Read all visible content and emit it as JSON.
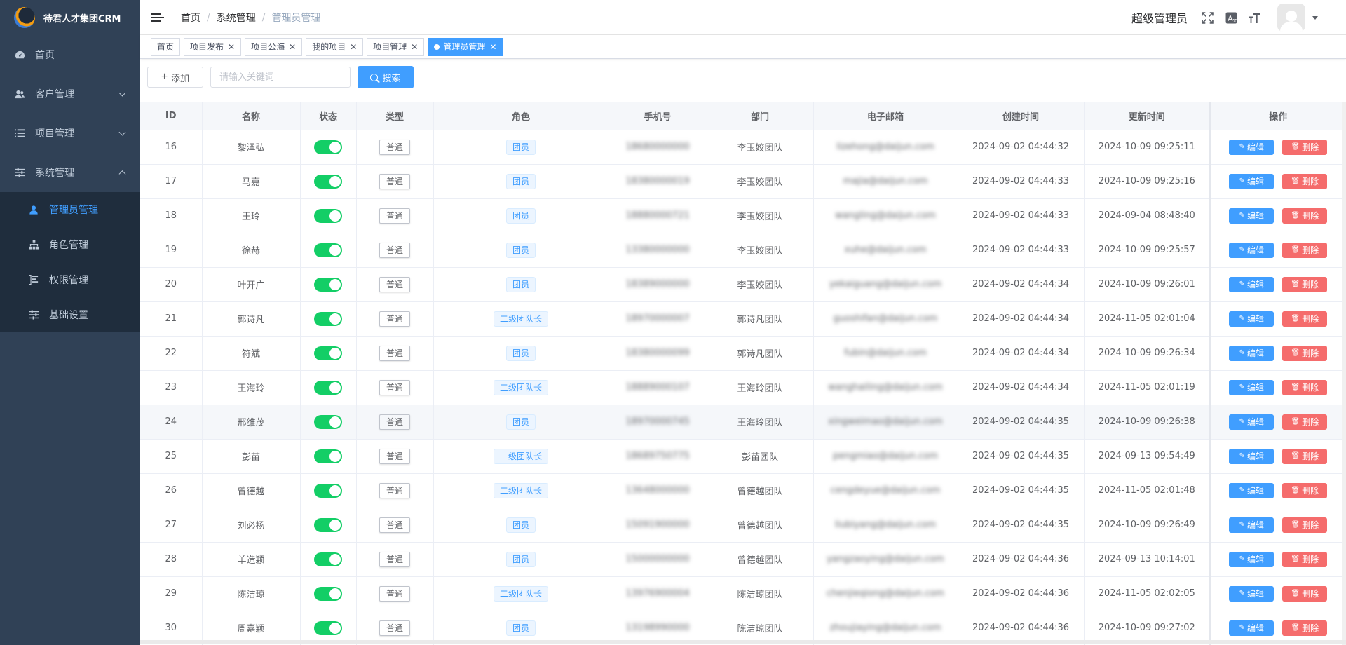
{
  "app": {
    "title": "待君人才集团CRM"
  },
  "sidebar": {
    "items": [
      {
        "label": "首页",
        "icon": "dashboard-icon"
      },
      {
        "label": "客户管理",
        "icon": "customers-icon"
      },
      {
        "label": "项目管理",
        "icon": "list-icon"
      },
      {
        "label": "系统管理",
        "icon": "sliders-icon"
      }
    ],
    "sub_items": [
      {
        "label": "管理员管理",
        "icon": "user-icon"
      },
      {
        "label": "角色管理",
        "icon": "org-icon"
      },
      {
        "label": "权限管理",
        "icon": "permission-icon"
      },
      {
        "label": "基础设置",
        "icon": "settings-icon"
      }
    ]
  },
  "header": {
    "breadcrumb": [
      "首页",
      "系统管理",
      "管理员管理"
    ],
    "username": "超级管理员"
  },
  "tags": [
    "首页",
    "项目发布",
    "项目公海",
    "我的项目",
    "项目管理",
    "管理员管理"
  ],
  "toolbar": {
    "add_label": "添加",
    "search_placeholder": "请输入关键词",
    "search_label": "搜索"
  },
  "table": {
    "headers": [
      "ID",
      "名称",
      "状态",
      "类型",
      "角色",
      "手机号",
      "部门",
      "电子邮箱",
      "创建时间",
      "更新时间",
      "操作"
    ],
    "edit_label": "编辑",
    "delete_label": "删除",
    "rows": [
      {
        "id": "16",
        "name": "黎泽弘",
        "type": "普通",
        "role": "团员",
        "phone": "18680000000",
        "dept": "李玉姣团队",
        "email": "lizehong@daijun.com",
        "created": "2024-09-02 04:44:32",
        "updated": "2024-10-09 09:25:11"
      },
      {
        "id": "17",
        "name": "马嘉",
        "type": "普通",
        "role": "团员",
        "phone": "18380000019",
        "dept": "李玉姣团队",
        "email": "majia@daijun.com",
        "created": "2024-09-02 04:44:33",
        "updated": "2024-10-09 09:25:16"
      },
      {
        "id": "18",
        "name": "王玲",
        "type": "普通",
        "role": "团员",
        "phone": "18880000721",
        "dept": "李玉姣团队",
        "email": "wangling@daijun.com",
        "created": "2024-09-02 04:44:33",
        "updated": "2024-09-04 08:48:40"
      },
      {
        "id": "19",
        "name": "徐赫",
        "type": "普通",
        "role": "团员",
        "phone": "13380000000",
        "dept": "李玉姣团队",
        "email": "xuhe@daijun.com",
        "created": "2024-09-02 04:44:33",
        "updated": "2024-10-09 09:25:57"
      },
      {
        "id": "20",
        "name": "叶开广",
        "type": "普通",
        "role": "团员",
        "phone": "18389000000",
        "dept": "李玉姣团队",
        "email": "yekaiguang@daijun.com",
        "created": "2024-09-02 04:44:34",
        "updated": "2024-10-09 09:26:01"
      },
      {
        "id": "21",
        "name": "郭诗凡",
        "type": "普通",
        "role": "二级团队长",
        "phone": "18970000007",
        "dept": "郭诗凡团队",
        "email": "guoshifan@daijun.com",
        "created": "2024-09-02 04:44:34",
        "updated": "2024-11-05 02:01:04"
      },
      {
        "id": "22",
        "name": "符斌",
        "type": "普通",
        "role": "团员",
        "phone": "18380000099",
        "dept": "郭诗凡团队",
        "email": "fubin@daijun.com",
        "created": "2024-09-02 04:44:34",
        "updated": "2024-10-09 09:26:34"
      },
      {
        "id": "23",
        "name": "王海玲",
        "type": "普通",
        "role": "二级团队长",
        "phone": "18889000107",
        "dept": "王海玲团队",
        "email": "wanghailing@daijun.com",
        "created": "2024-09-02 04:44:34",
        "updated": "2024-11-05 02:01:19"
      },
      {
        "id": "24",
        "name": "邢维茂",
        "type": "普通",
        "role": "团员",
        "phone": "18970000745",
        "dept": "王海玲团队",
        "email": "xingweimao@daijun.com",
        "created": "2024-09-02 04:44:35",
        "updated": "2024-10-09 09:26:38"
      },
      {
        "id": "25",
        "name": "彭苗",
        "type": "普通",
        "role": "一级团队长",
        "phone": "18689750775",
        "dept": "彭苗团队",
        "email": "pengmiao@daijun.com",
        "created": "2024-09-02 04:44:35",
        "updated": "2024-09-13 09:54:49"
      },
      {
        "id": "26",
        "name": "曾德越",
        "type": "普通",
        "role": "二级团队长",
        "phone": "13648000000",
        "dept": "曾德越团队",
        "email": "cengdeyue@daijun.com",
        "created": "2024-09-02 04:44:35",
        "updated": "2024-11-05 02:01:48"
      },
      {
        "id": "27",
        "name": "刘必扬",
        "type": "普通",
        "role": "团员",
        "phone": "15091900000",
        "dept": "曾德越团队",
        "email": "liubiyang@daijun.com",
        "created": "2024-09-02 04:44:35",
        "updated": "2024-10-09 09:26:49"
      },
      {
        "id": "28",
        "name": "羊造颖",
        "type": "普通",
        "role": "团员",
        "phone": "15000000000",
        "dept": "曾德越团队",
        "email": "yangzaoying@daijun.com",
        "created": "2024-09-02 04:44:36",
        "updated": "2024-09-13 10:14:01"
      },
      {
        "id": "29",
        "name": "陈洁琼",
        "type": "普通",
        "role": "二级团队长",
        "phone": "13976900004",
        "dept": "陈洁琼团队",
        "email": "chenjieqiong@daijun.com",
        "created": "2024-09-02 04:44:36",
        "updated": "2024-11-05 02:02:05"
      },
      {
        "id": "30",
        "name": "周嘉颖",
        "type": "普通",
        "role": "团员",
        "phone": "13198990000",
        "dept": "陈洁琼团队",
        "email": "zhoujiaying@daijun.com",
        "created": "2024-09-02 04:44:36",
        "updated": "2024-10-09 09:27:02"
      }
    ]
  },
  "colors": {
    "sidebar_bg": "#304156",
    "sub_bg": "#1f2d3d",
    "primary": "#409eff",
    "danger": "#f56c6c",
    "switch_on": "#13ce66"
  }
}
